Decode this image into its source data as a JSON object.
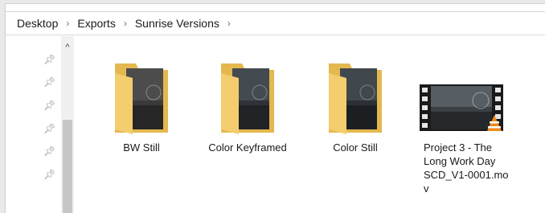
{
  "breadcrumb": {
    "items": [
      {
        "label": "Desktop"
      },
      {
        "label": "Exports"
      },
      {
        "label": "Sunrise Versions"
      }
    ],
    "separator": "›"
  },
  "nav_pane": {
    "pins": [
      "pin-icon",
      "pin-icon",
      "pin-icon",
      "pin-icon",
      "pin-icon",
      "pin-icon"
    ],
    "scroll_up_glyph": "^"
  },
  "files": [
    {
      "name": "BW Still",
      "type": "folder"
    },
    {
      "name": "Color Keyframed",
      "type": "folder"
    },
    {
      "name": "Color Still",
      "type": "folder"
    },
    {
      "name": "Project 3 - The Long Work Day SCD_V1-0001.mov",
      "type": "video",
      "display_lines": [
        "Project 3 - The",
        "Long Work Day",
        "SCD_V1-0001.mo",
        "v"
      ]
    }
  ],
  "colors": {
    "folder": "#f3cd6e",
    "folder_back": "#e4b84f",
    "vlc_orange": "#f08a1c"
  }
}
